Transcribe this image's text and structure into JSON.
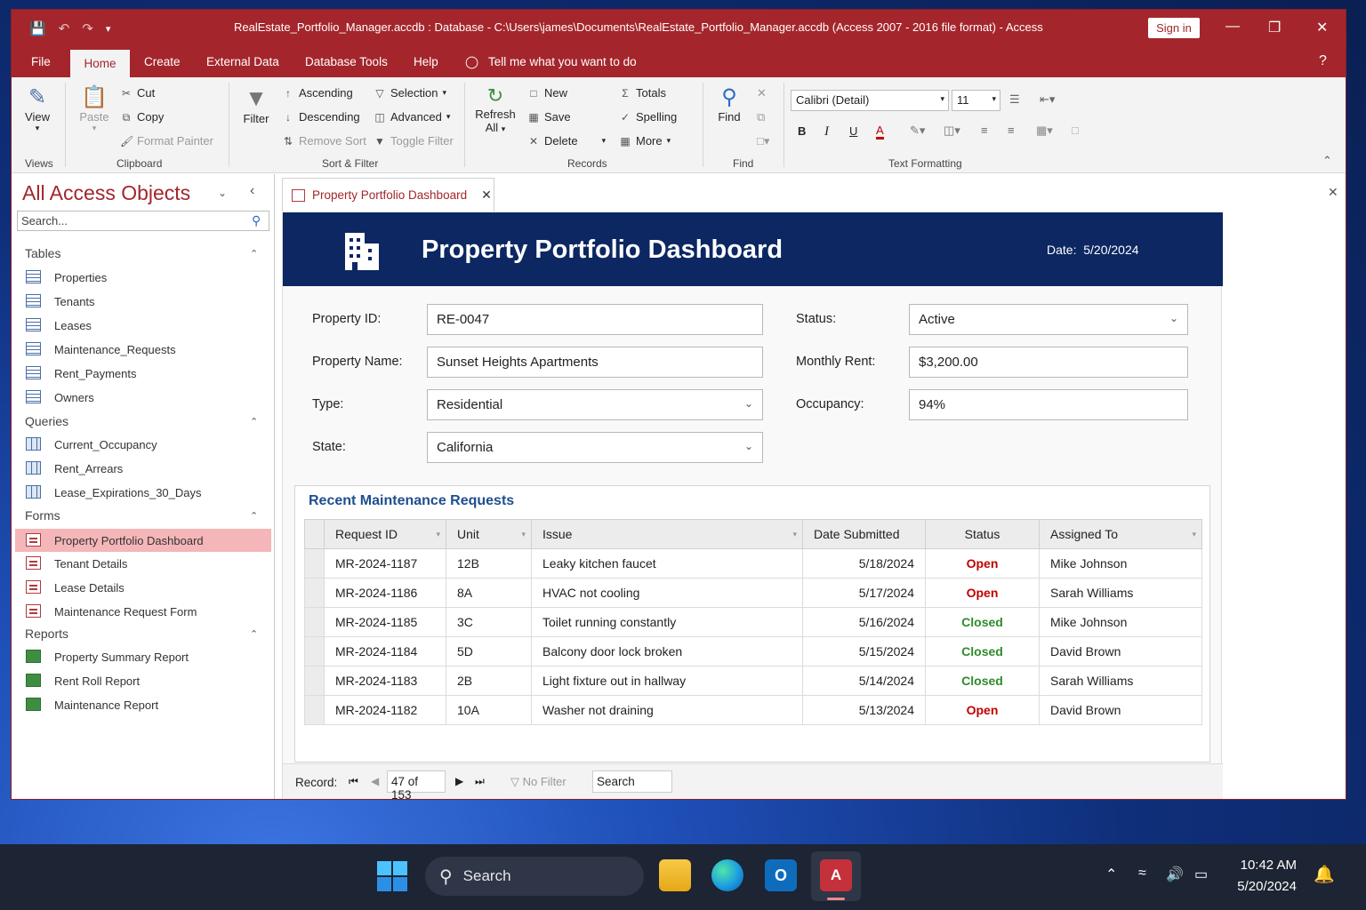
{
  "window": {
    "title": "RealEstate_Portfolio_Manager.accdb : Database - C:\\Users\\james\\Documents\\RealEstate_Portfolio_Manager.accdb (Access 2007 - 2016 file format)  -  Access",
    "sign_in": "Sign in"
  },
  "ribbon_tabs": {
    "file": "File",
    "home": "Home",
    "create": "Create",
    "external": "External Data",
    "dbtools": "Database Tools",
    "help": "Help",
    "tell": "Tell me what you want to do"
  },
  "ribbon": {
    "view": "View",
    "paste": "Paste",
    "cut": "Cut",
    "copy": "Copy",
    "format_painter": "Format Painter",
    "filter": "Filter",
    "ascending": "Ascending",
    "descending": "Descending",
    "remove_sort": "Remove Sort",
    "selection": "Selection",
    "advanced": "Advanced",
    "toggle_filter": "Toggle Filter",
    "refresh": "Refresh",
    "refresh2": "All",
    "new": "New",
    "save": "Save",
    "delete": "Delete",
    "totals": "Totals",
    "spelling": "Spelling",
    "more": "More",
    "find": "Find",
    "font": "Calibri (Detail)",
    "font_size": "11",
    "groups": {
      "views": "Views",
      "clipboard": "Clipboard",
      "sortfilter": "Sort & Filter",
      "records": "Records",
      "find": "Find",
      "textformat": "Text Formatting"
    }
  },
  "nav": {
    "title": "All Access Objects",
    "search_placeholder": "Search...",
    "tables_header": "Tables",
    "queries_header": "Queries",
    "forms_header": "Forms",
    "reports_header": "Reports",
    "tables": [
      "Properties",
      "Tenants",
      "Leases",
      "Maintenance_Requests",
      "Rent_Payments",
      "Owners"
    ],
    "queries": [
      "Current_Occupancy",
      "Rent_Arrears",
      "Lease_Expirations_30_Days"
    ],
    "forms": [
      "Property Portfolio Dashboard",
      "Tenant Details",
      "Lease Details",
      "Maintenance Request Form"
    ],
    "reports": [
      "Property Summary Report",
      "Rent Roll Report",
      "Maintenance Report"
    ]
  },
  "doc_tab": "Property Portfolio Dashboard",
  "form": {
    "title": "Property Portfolio Dashboard",
    "date_label": "Date:",
    "date_value": "5/20/2024",
    "property_id_label": "Property ID:",
    "property_id": "RE-0047",
    "property_name_label": "Property Name:",
    "property_name": "Sunset Heights Apartments",
    "type_label": "Type:",
    "type": "Residential",
    "state_label": "State:",
    "state": "California",
    "status_label": "Status:",
    "status": "Active",
    "rent_label": "Monthly Rent:",
    "rent": "$3,200.00",
    "occupancy_label": "Occupancy:",
    "occupancy": "94%"
  },
  "maintenance": {
    "title": "Recent Maintenance Requests",
    "columns": [
      "Request ID",
      "Unit",
      "Issue",
      "Date Submitted",
      "Status",
      "Assigned To"
    ],
    "rows": [
      [
        "MR-2024-1187",
        "12B",
        "Leaky kitchen faucet",
        "5/18/2024",
        "Open",
        "Mike Johnson"
      ],
      [
        "MR-2024-1186",
        "8A",
        "HVAC not cooling",
        "5/17/2024",
        "Open",
        "Sarah Williams"
      ],
      [
        "MR-2024-1185",
        "3C",
        "Toilet running constantly",
        "5/16/2024",
        "Closed",
        "Mike Johnson"
      ],
      [
        "MR-2024-1184",
        "5D",
        "Balcony door lock broken",
        "5/15/2024",
        "Closed",
        "David Brown"
      ],
      [
        "MR-2024-1183",
        "2B",
        "Light fixture out in hallway",
        "5/14/2024",
        "Closed",
        "Sarah Williams"
      ],
      [
        "MR-2024-1182",
        "10A",
        "Washer not draining",
        "5/13/2024",
        "Open",
        "David Brown"
      ]
    ]
  },
  "record_nav": {
    "label": "Record:",
    "position": "47 of 153",
    "no_filter": "No Filter",
    "search": "Search"
  },
  "taskbar": {
    "search": "Search",
    "time": "10:42 AM",
    "date": "5/20/2024"
  }
}
